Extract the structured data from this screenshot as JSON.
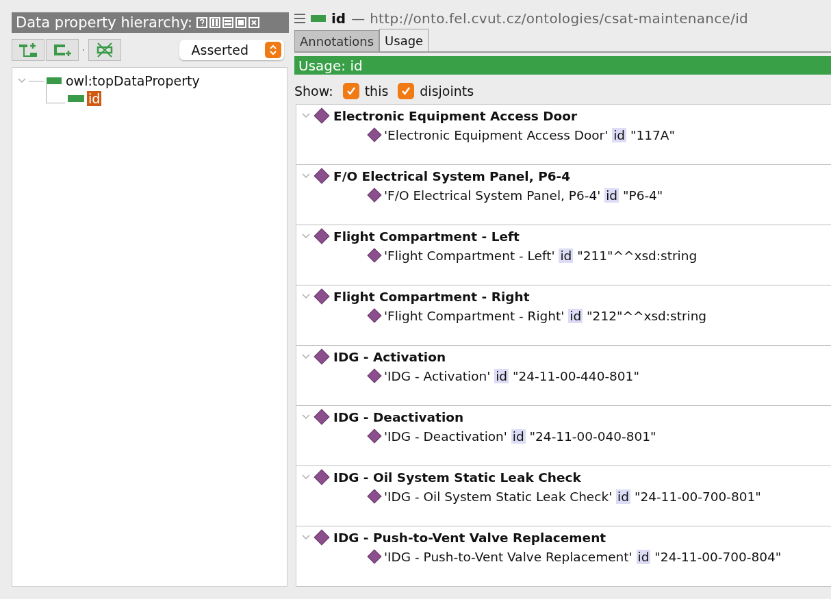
{
  "left_panel": {
    "title": "Data property hierarchy:",
    "mode": "Asserted",
    "tree": [
      {
        "label": "owl:topDataProperty",
        "expanded": true,
        "selected": false,
        "children": [
          {
            "label": "id",
            "selected": true
          }
        ]
      }
    ]
  },
  "entity": {
    "name": "id",
    "iri": "— http://onto.fel.cvut.cz/ontologies/csat-maintenance/id"
  },
  "tabs": [
    {
      "label": "Annotations",
      "selected": false
    },
    {
      "label": "Usage",
      "selected": true
    }
  ],
  "usage": {
    "title": "Usage: id",
    "show_label": "Show:",
    "filters": [
      {
        "label": "this",
        "checked": true
      },
      {
        "label": "disjoints",
        "checked": true
      }
    ],
    "groups": [
      {
        "heading": "Electronic Equipment Access Door",
        "expanded": true,
        "axiom": {
          "subject": "'Electronic Equipment Access Door'",
          "property": "id",
          "value": "\"117A\""
        }
      },
      {
        "heading": "F/O Electrical System Panel, P6-4",
        "expanded": true,
        "axiom": {
          "subject": "'F/O Electrical System Panel, P6-4'",
          "property": "id",
          "value": "\"P6-4\""
        }
      },
      {
        "heading": "Flight Compartment - Left",
        "expanded": true,
        "axiom": {
          "subject": "'Flight Compartment - Left'",
          "property": "id",
          "value": "\"211\"^^xsd:string"
        }
      },
      {
        "heading": "Flight Compartment - Right",
        "expanded": true,
        "axiom": {
          "subject": "'Flight Compartment - Right'",
          "property": "id",
          "value": "\"212\"^^xsd:string"
        }
      },
      {
        "heading": "IDG - Activation",
        "expanded": true,
        "axiom": {
          "subject": "'IDG - Activation'",
          "property": "id",
          "value": "\"24-11-00-440-801\""
        }
      },
      {
        "heading": "IDG - Deactivation",
        "expanded": true,
        "axiom": {
          "subject": "'IDG - Deactivation'",
          "property": "id",
          "value": "\"24-11-00-040-801\""
        }
      },
      {
        "heading": "IDG - Oil System Static Leak Check",
        "expanded": true,
        "axiom": {
          "subject": "'IDG - Oil System Static Leak Check'",
          "property": "id",
          "value": "\"24-11-00-700-801\""
        }
      },
      {
        "heading": "IDG - Push-to-Vent Valve Replacement",
        "expanded": true,
        "axiom": {
          "subject": "'IDG - Push-to-Vent Valve Replacement'",
          "property": "id",
          "value": "\"24-11-00-700-804\""
        }
      }
    ]
  }
}
